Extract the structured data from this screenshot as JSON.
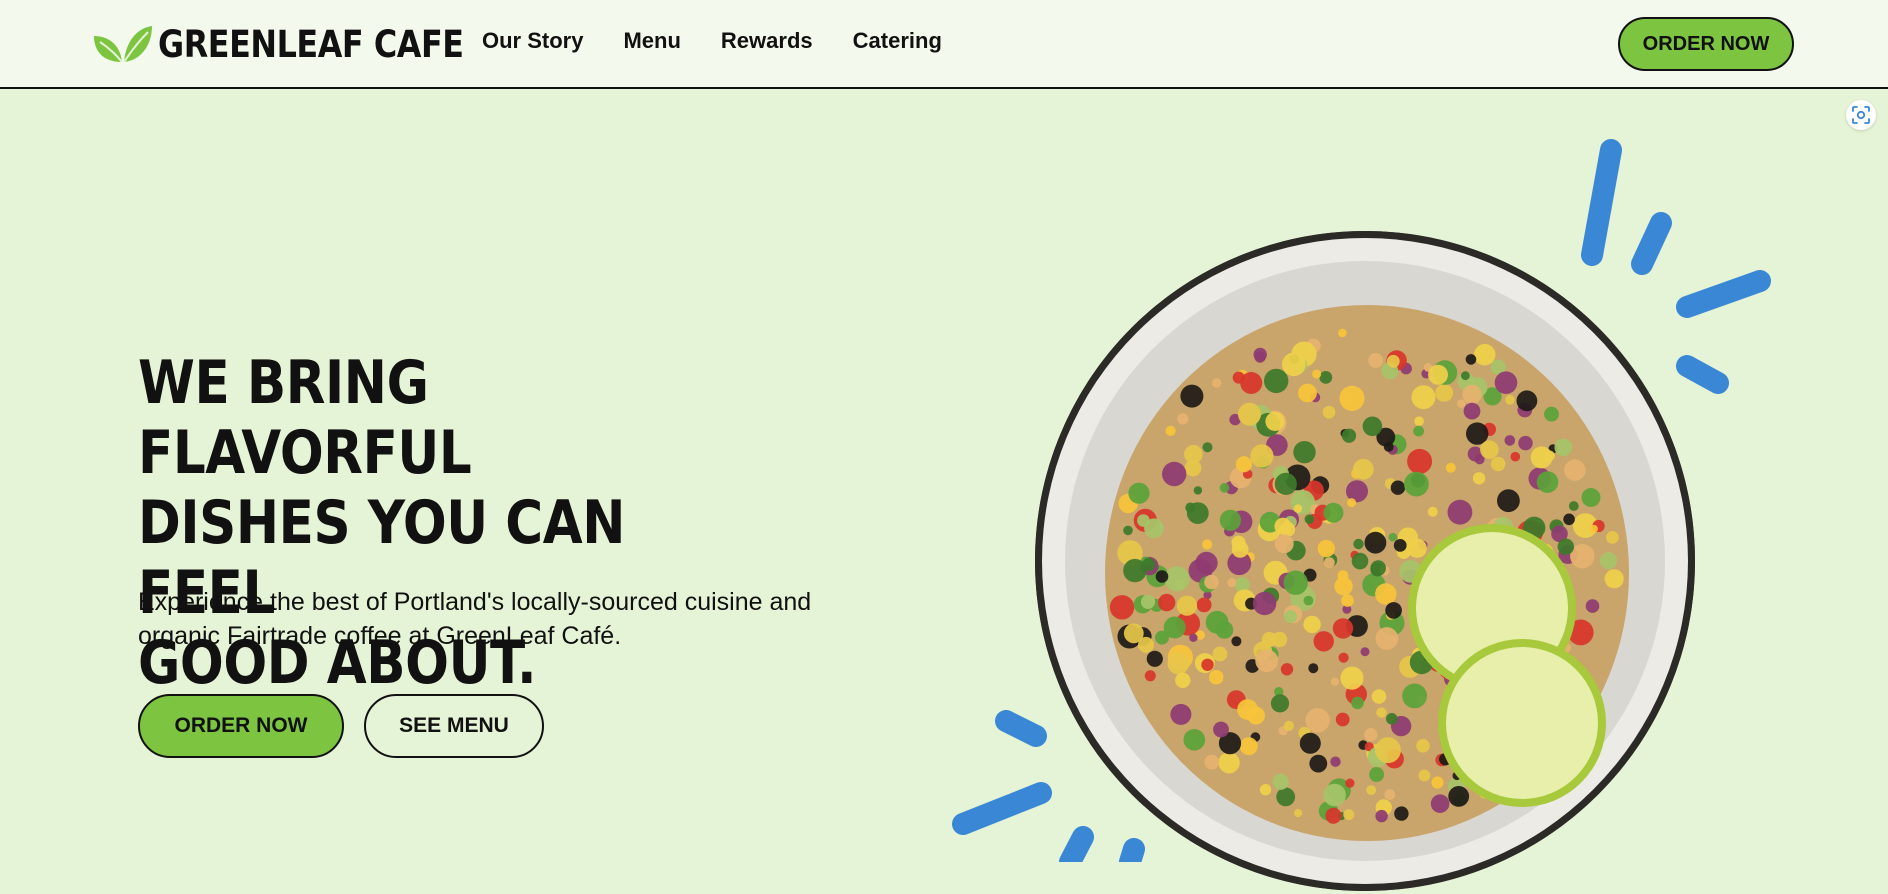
{
  "header": {
    "brand": "GREENLEAF CAFE",
    "nav": [
      "Our Story",
      "Menu",
      "Rewards",
      "Catering"
    ],
    "order_label": "ORDER NOW"
  },
  "hero": {
    "title_lines": [
      "WE BRING FLAVORFUL",
      "DISHES YOU CAN FEEL",
      "GOOD ABOUT."
    ],
    "subtitle_line1": "Experience the best of Portland's locally-sourced cuisine and",
    "subtitle_line2": "organic Fairtrade coffee at GreenLeaf Café.",
    "order_label": "ORDER NOW",
    "menu_label": "SEE MENU"
  },
  "icons": {
    "logo": "leaf-icon",
    "corner": "screenshot-capture-icon"
  },
  "colors": {
    "background": "#e5f3d6",
    "header_bg": "#f3faed",
    "accent_green": "#7dc540",
    "burst_blue": "#3a87d6",
    "text": "#111111"
  }
}
